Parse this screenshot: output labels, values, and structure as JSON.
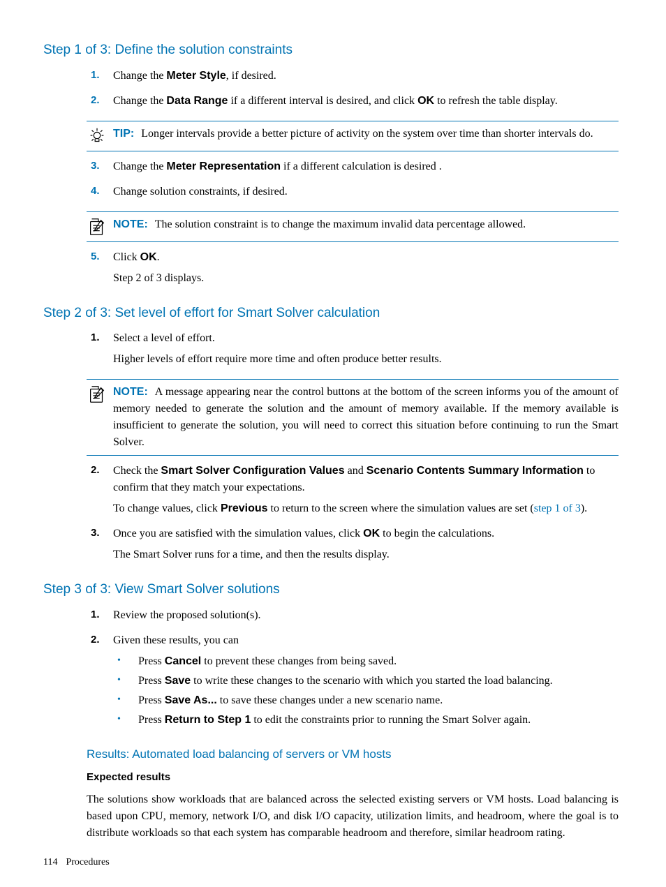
{
  "step1": {
    "heading": "Step 1 of 3: Define the solution constraints",
    "items": {
      "1": {
        "num": "1.",
        "pre": "Change the ",
        "bold": "Meter Style",
        "post": ", if desired."
      },
      "2": {
        "num": "2.",
        "pre": "Change the ",
        "bold": "Data Range",
        "mid": " if a different interval is desired, and click ",
        "bold2": "OK",
        "post": " to refresh the table display."
      },
      "3": {
        "num": "3.",
        "pre": "Change the ",
        "bold": "Meter Representation",
        "post": " if a different calculation is desired ."
      },
      "4": {
        "num": "4.",
        "text": "Change solution constraints, if desired."
      },
      "5": {
        "num": "5.",
        "pre": "Click ",
        "bold": "OK",
        "post": ".",
        "sub": "Step 2 of 3 displays."
      }
    }
  },
  "tip": {
    "label": "TIP:",
    "text": "Longer intervals provide a better picture of activity on the system over time than shorter intervals do."
  },
  "note1": {
    "label": "NOTE:",
    "text": "The solution constraint is to change the maximum invalid data percentage allowed."
  },
  "step2": {
    "heading": "Step 2 of 3: Set level of effort for Smart Solver calculation",
    "items": {
      "1": {
        "num": "1.",
        "text": "Select a level of effort.",
        "sub": "Higher levels of effort require more time and often produce better results."
      },
      "2": {
        "num": "2.",
        "pre": "Check the ",
        "bold1": "Smart Solver Configuration Values",
        "mid": " and ",
        "bold2": "Scenario Contents Summary Information",
        "post": " to confirm that they match your expectations.",
        "sub_pre": "To change values, click ",
        "sub_bold": "Previous",
        "sub_mid": " to return to the screen where the simulation values are set (",
        "sub_link": "step 1 of 3",
        "sub_post": ")."
      },
      "3": {
        "num": "3.",
        "pre": "Once you are satisfied with the simulation values, click ",
        "bold": "OK",
        "post": " to begin the calculations.",
        "sub": "The Smart Solver runs for a time, and then the results display."
      }
    }
  },
  "note2": {
    "label": "NOTE:",
    "text": "A message appearing near the control buttons at the bottom of the screen informs you of the amount of memory needed to generate the solution and the amount of memory available. If the memory available is insufficient to generate the solution, you will need to correct this situation before continuing to run the Smart Solver."
  },
  "step3": {
    "heading": "Step 3 of 3: View Smart Solver solutions",
    "items": {
      "1": {
        "num": "1.",
        "text": "Review the proposed solution(s)."
      },
      "2": {
        "num": "2.",
        "text": "Given these results, you can",
        "bullets": {
          "a": {
            "pre": "Press ",
            "bold": "Cancel",
            "post": " to prevent these changes from being saved."
          },
          "b": {
            "pre": "Press ",
            "bold": "Save",
            "post": " to write these changes to the scenario with which you started the load balancing."
          },
          "c": {
            "pre": "Press ",
            "bold": "Save As...",
            "post": " to save these changes under a new scenario name."
          },
          "d": {
            "pre": "Press ",
            "bold": "Return to Step 1",
            "post": " to edit the constraints prior to running the Smart Solver again."
          }
        }
      }
    }
  },
  "results": {
    "heading": "Results: Automated load balancing of servers or VM hosts",
    "subheading": "Expected results",
    "text": "The solutions show workloads that are balanced across the selected existing servers or VM hosts. Load balancing is based upon CPU, memory, network I/O, and disk I/O capacity, utilization limits, and headroom, where the goal is to distribute workloads so that each system has comparable headroom and therefore, similar headroom rating."
  },
  "footer": {
    "page": "114",
    "section": "Procedures"
  }
}
